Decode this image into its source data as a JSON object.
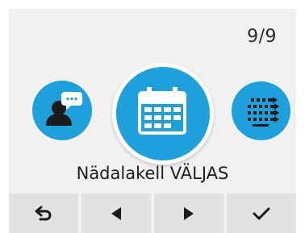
{
  "header": {
    "page_counter": "9/9"
  },
  "menu": {
    "label": "Nädalakell VÄLJAS",
    "accent_color": "#1da0dc",
    "icons": {
      "left": "contact-speech-icon",
      "center": "calendar-icon",
      "right": "list-arrows-icon"
    }
  },
  "bottom_bar": {
    "buttons": [
      "back-icon",
      "arrow-left-icon",
      "arrow-right-icon",
      "checkmark-icon"
    ]
  }
}
